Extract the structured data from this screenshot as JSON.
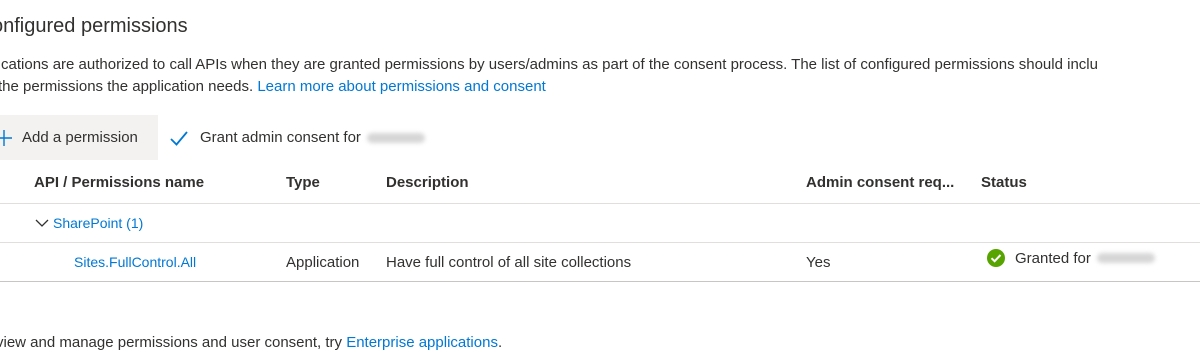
{
  "section": {
    "title": "onfigured permissions",
    "description_line1": "plications are authorized to call APIs when they are granted permissions by users/admins as part of the consent process. The list of configured permissions should inclu",
    "description_line2": "the permissions the application needs.",
    "learn_more_link": "Learn more about permissions and consent"
  },
  "toolbar": {
    "add_label": "Add a permission",
    "grant_label": "Grant admin consent for"
  },
  "table": {
    "headers": {
      "name": "API / Permissions name",
      "type": "Type",
      "description": "Description",
      "admin": "Admin consent req...",
      "status": "Status"
    },
    "group": {
      "label": "SharePoint (1)"
    },
    "rows": [
      {
        "name": "Sites.FullControl.All",
        "type": "Application",
        "description": "Have full control of all site collections",
        "admin": "Yes",
        "status": "Granted for"
      }
    ]
  },
  "footer": {
    "text": "view and manage permissions and user consent, try ",
    "link": "Enterprise applications",
    "suffix": "."
  },
  "colors": {
    "link": "#0078d4",
    "granted": "#57a300",
    "toolbar_hover": "#f3f2f1",
    "divider": "#e1dfdd"
  },
  "icons": {
    "add": "plus-icon",
    "grant": "checkmark-icon",
    "group_toggle": "chevron-down-icon",
    "status": "check-circle-icon"
  }
}
